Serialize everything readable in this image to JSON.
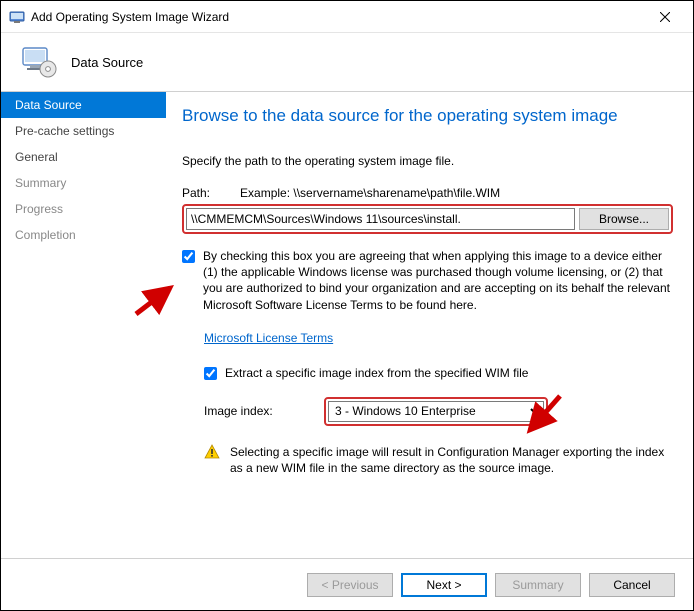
{
  "window": {
    "title": "Add Operating System Image Wizard"
  },
  "header": {
    "page_name": "Data Source"
  },
  "sidebar": {
    "items": [
      {
        "label": "Data Source",
        "state": "active"
      },
      {
        "label": "Pre-cache settings",
        "state": ""
      },
      {
        "label": "General",
        "state": ""
      },
      {
        "label": "Summary",
        "state": "muted"
      },
      {
        "label": "Progress",
        "state": "muted"
      },
      {
        "label": "Completion",
        "state": "muted"
      }
    ]
  },
  "content": {
    "heading": "Browse to the data source for the operating system image",
    "lead": "Specify the path to the operating system image file.",
    "path_label": "Path:",
    "path_example": "Example: \\\\servername\\sharename\\path\\file.WIM",
    "path_value": "\\\\CMMEMCM\\Sources\\Windows 11\\sources\\install.",
    "browse_label": "Browse...",
    "eula_checked": true,
    "eula_text": "By checking this box you are agreeing that when applying this image to a device either (1) the applicable Windows license was purchased though volume licensing, or (2) that you are authorized to bind your organization and are accepting on its behalf the relevant Microsoft Software License Terms to be found here.",
    "license_link": "Microsoft License Terms",
    "extract_checked": true,
    "extract_text": "Extract a specific image index from the specified WIM file",
    "index_label": "Image index:",
    "index_value": "3 - Windows 10 Enterprise",
    "warn_text": "Selecting a specific image will result in Configuration Manager exporting the index as a new WIM file in the same directory as the source image."
  },
  "footer": {
    "previous": "< Previous",
    "next": "Next >",
    "summary": "Summary",
    "cancel": "Cancel"
  }
}
